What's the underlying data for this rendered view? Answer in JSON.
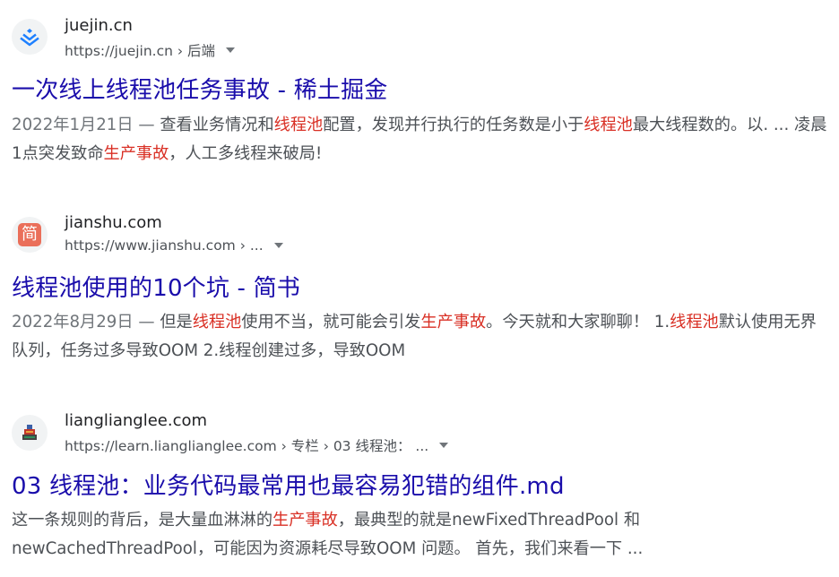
{
  "results": [
    {
      "site_name": "juejin.cn",
      "url": "https://juejin.cn › 后端",
      "title": "一次线上线程池任务事故 - 稀土掘金",
      "snippet": [
        {
          "t": "2022年1月21日 — ",
          "c": "date"
        },
        {
          "t": "查看业务情况和",
          "c": ""
        },
        {
          "t": "线程池",
          "c": "hl"
        },
        {
          "t": "配置，发现并行执行的任务数是小于",
          "c": ""
        },
        {
          "t": "线程池",
          "c": "hl"
        },
        {
          "t": "最大线程数的。以. ... 凌晨1点突发致命",
          "c": ""
        },
        {
          "t": "生产事故",
          "c": "hl"
        },
        {
          "t": "，人工多线程来破局!",
          "c": ""
        }
      ]
    },
    {
      "site_name": "jianshu.com",
      "url": "https://www.jianshu.com › ...",
      "title": "线程池使用的10个坑 - 简书",
      "snippet": [
        {
          "t": "2022年8月29日 — ",
          "c": "date"
        },
        {
          "t": "但是",
          "c": ""
        },
        {
          "t": "线程池",
          "c": "hl"
        },
        {
          "t": "使用不当，就可能会引发",
          "c": ""
        },
        {
          "t": "生产事故",
          "c": "hl"
        },
        {
          "t": "。今天就和大家聊聊！ 1.",
          "c": ""
        },
        {
          "t": "线程池",
          "c": "hl"
        },
        {
          "t": "默认使用无界队列，任务过多导致OOM 2.线程创建过多，导致OOM",
          "c": ""
        }
      ]
    },
    {
      "site_name": "lianglianglee.com",
      "url": "https://learn.lianglianglee.com › 专栏 › 03 线程池： ...",
      "title": "03 线程池：业务代码最常用也最容易犯错的组件.md",
      "snippet": [
        {
          "t": "这一条规则的背后，是大量血淋淋的",
          "c": ""
        },
        {
          "t": "生产事故",
          "c": "hl"
        },
        {
          "t": "，最典型的就是newFixedThreadPool 和 newCachedThreadPool，可能因为资源耗尽导致OOM 问题。 首先，我们来看一下 ...",
          "c": ""
        }
      ]
    }
  ],
  "favicons": [
    {
      "icon": "juejin-logo-icon",
      "color": "#1e80ff"
    },
    {
      "icon": "jianshu-logo-icon",
      "glyph": "简",
      "color": "#ea6f5a"
    },
    {
      "icon": "lianglianglee-logo-icon",
      "color": "#555555"
    }
  ],
  "colors": {
    "title": "#1a0dab",
    "highlight": "#d93025",
    "url": "#4d5156"
  }
}
